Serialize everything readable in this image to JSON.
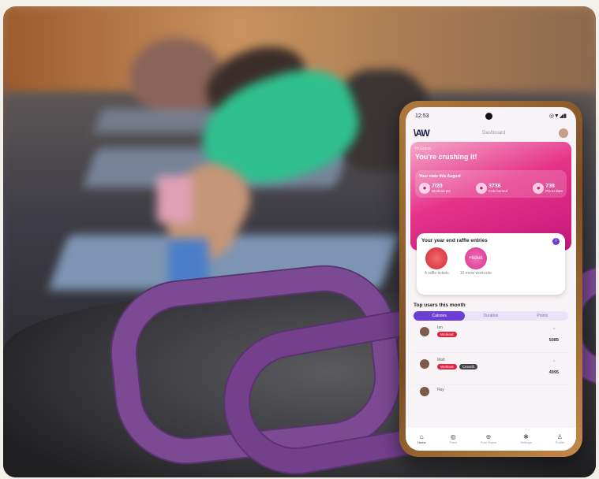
{
  "status_bar": {
    "time": "12:53",
    "icons": "◎▼◢▮"
  },
  "app": {
    "logo": "\\AW",
    "header_title": "Dashboard"
  },
  "hero": {
    "greeting": "Hi Grace,",
    "title": "You're crushing it!",
    "stats_heading": "Your stats this August",
    "stats": [
      {
        "value": "7/20",
        "label": "Workout pts"
      },
      {
        "value": "3736",
        "label": "Cals burned"
      },
      {
        "value": "739",
        "label": "Pts to dare"
      }
    ]
  },
  "raffle": {
    "title": "Your year end raffle entries",
    "items": [
      {
        "circle": "",
        "label": "4 raffle tickets"
      },
      {
        "circle": "+ticket",
        "label": "10 more workouts"
      }
    ]
  },
  "top_users": {
    "title": "Top users this month",
    "tabs": [
      "Calories",
      "Duration",
      "Points"
    ],
    "rows": [
      {
        "name": "Ian",
        "badges": [
          "Workout"
        ],
        "score": "5085"
      },
      {
        "name": "Matt",
        "badges": [
          "Workout",
          "Crossfit"
        ],
        "score": "4995"
      },
      {
        "name": "Ray",
        "badges": [],
        "score": ""
      }
    ]
  },
  "nav": [
    "Home",
    "Feed",
    "Post Status",
    "Settings",
    "Profile"
  ],
  "colors": {
    "accent": "#6b3fd4",
    "hero_pink": "#e6338a",
    "band_purple": "#7b4a93"
  }
}
